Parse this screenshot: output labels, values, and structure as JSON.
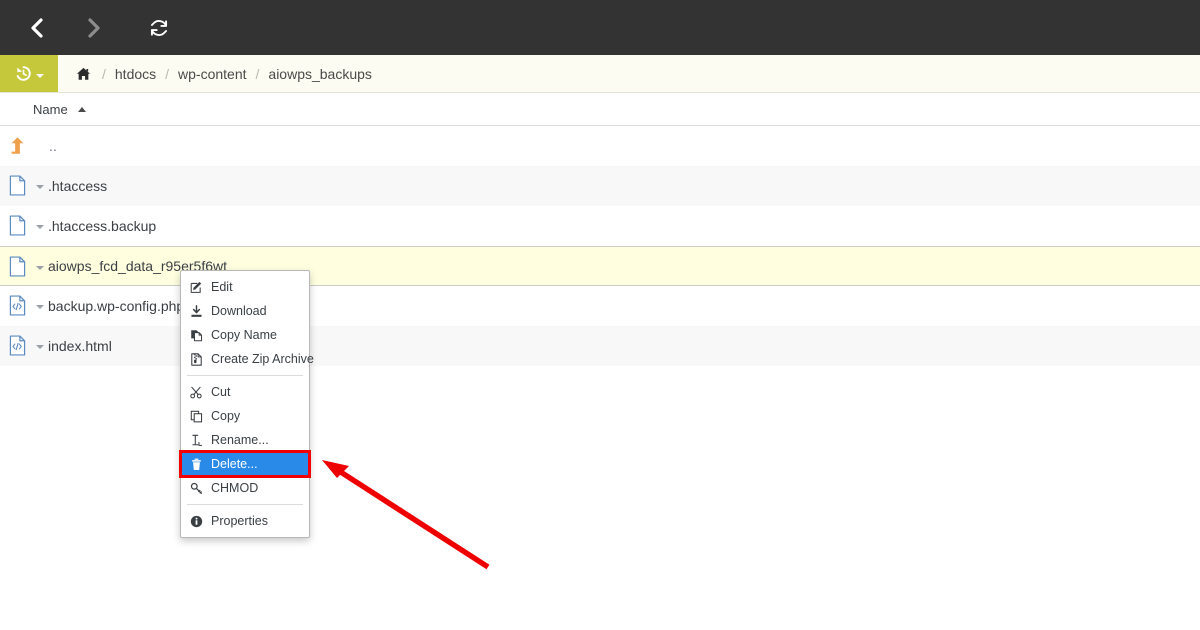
{
  "toolbar": {
    "back_label": "Back",
    "back_icon": "chevron-left-icon",
    "forward_label": "Forward",
    "forward_icon": "chevron-right-icon",
    "reload_label": "Reload",
    "reload_icon": "refresh-icon",
    "background_color": "#333333"
  },
  "breadcrumb": {
    "restore_icon": "history-restore-icon",
    "restore_caret_icon": "chevron-down-icon",
    "restore_bg_color": "#c6c83c",
    "bar_bg_color": "#fcfcf3",
    "home_icon": "home-icon",
    "separator": "/",
    "items": [
      {
        "label": "htdocs"
      },
      {
        "label": "wp-content"
      },
      {
        "label": "aiowps_backups"
      }
    ]
  },
  "table": {
    "header": {
      "name_label": "Name",
      "sort_icon": "sort-ascending-icon",
      "sort_direction": "asc"
    },
    "rows": [
      {
        "name": "..",
        "icon": "up-directory-icon",
        "type": "updir",
        "shade": "plain",
        "selected": false,
        "has_caret": false
      },
      {
        "name": ".htaccess",
        "icon": "file-icon",
        "type": "file",
        "shade": "shade",
        "selected": false,
        "has_caret": true
      },
      {
        "name": ".htaccess.backup",
        "icon": "file-icon",
        "type": "file",
        "shade": "plain",
        "selected": false,
        "has_caret": true
      },
      {
        "name": "aiowps_fcd_data_r95er5f6wt",
        "icon": "file-icon",
        "type": "file",
        "shade": "selected",
        "selected": true,
        "has_caret": true
      },
      {
        "name": "backup.wp-config.php",
        "icon": "code-file-icon",
        "type": "file",
        "shade": "plain",
        "selected": false,
        "has_caret": true
      },
      {
        "name": "index.html",
        "icon": "code-file-icon",
        "type": "file",
        "shade": "shade",
        "selected": false,
        "has_caret": true
      }
    ]
  },
  "context_menu": {
    "highlight_color": "#2a8ae8",
    "highlight_outline_color": "#f40000",
    "items": [
      {
        "label": "Edit",
        "icon": "edit-pencil-icon",
        "active": false,
        "separator_after": false
      },
      {
        "label": "Download",
        "icon": "download-icon",
        "active": false,
        "separator_after": false
      },
      {
        "label": "Copy Name",
        "icon": "copy-name-icon",
        "active": false,
        "separator_after": false
      },
      {
        "label": "Create Zip Archive",
        "icon": "zip-archive-icon",
        "active": false,
        "separator_after": true
      },
      {
        "label": "Cut",
        "icon": "scissors-icon",
        "active": false,
        "separator_after": false
      },
      {
        "label": "Copy",
        "icon": "copy-icon",
        "active": false,
        "separator_after": false
      },
      {
        "label": "Rename...",
        "icon": "text-cursor-icon",
        "active": false,
        "separator_after": false
      },
      {
        "label": "Delete...",
        "icon": "trash-icon",
        "active": true,
        "separator_after": false
      },
      {
        "label": "CHMOD",
        "icon": "key-icon",
        "active": false,
        "separator_after": true
      },
      {
        "label": "Properties",
        "icon": "info-icon",
        "active": false,
        "separator_after": false
      }
    ]
  },
  "annotation": {
    "arrow_color": "#ee0000",
    "arrow_name": "red-pointer-arrow",
    "points_to": "Delete..."
  }
}
